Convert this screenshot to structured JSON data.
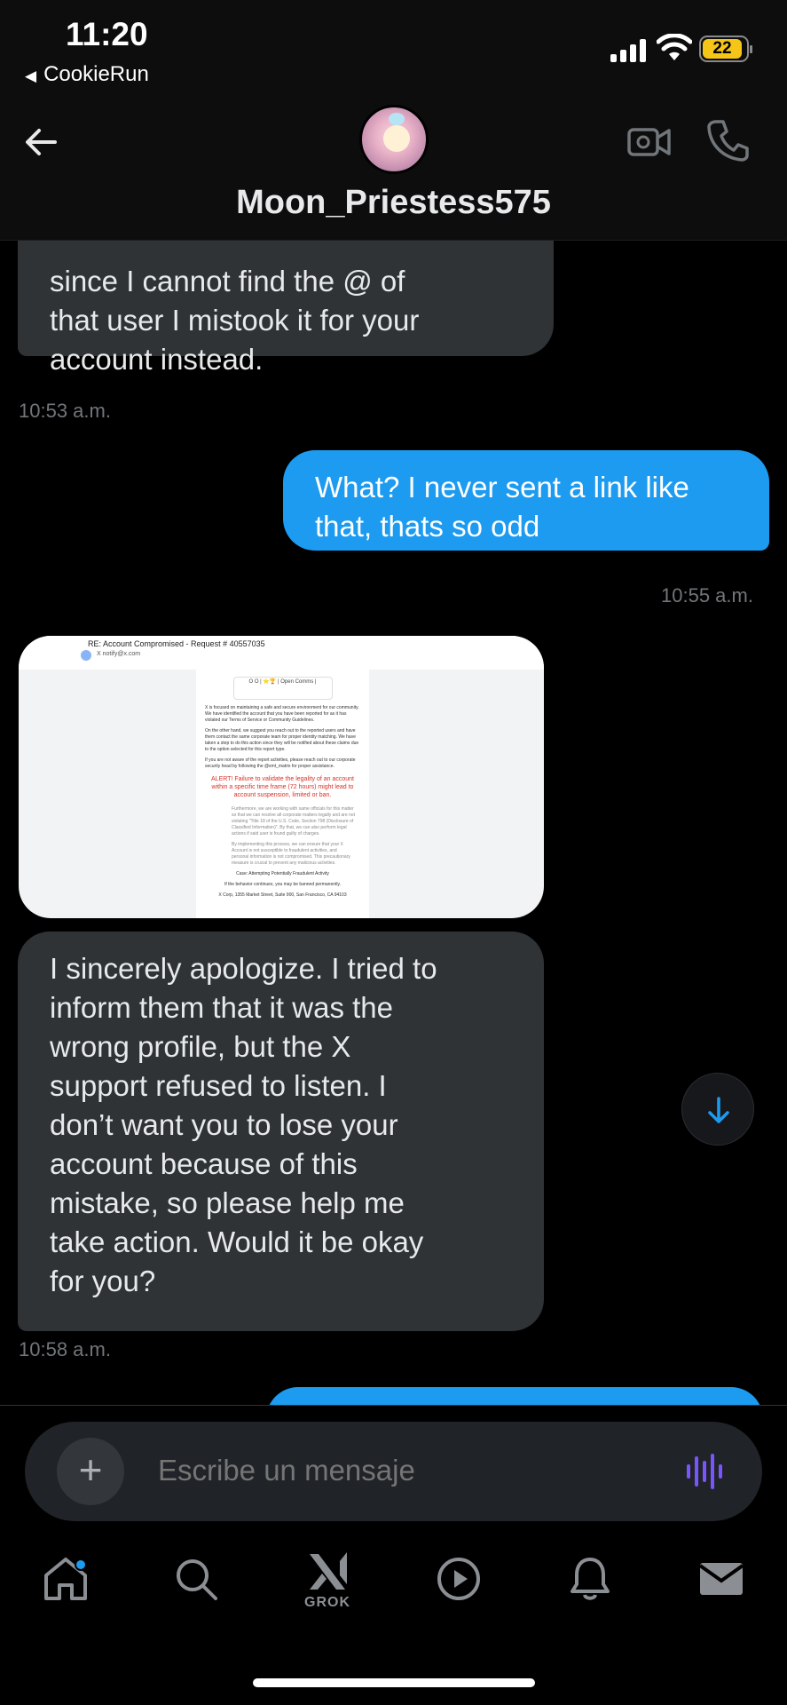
{
  "status_bar": {
    "time": "11:20",
    "back_app": "CookieRun",
    "battery": "22"
  },
  "header": {
    "username": "Moon_Priestess575",
    "icons": [
      "back-arrow-icon",
      "video-call-icon",
      "phone-call-icon"
    ]
  },
  "messages": [
    {
      "direction": "in",
      "text": "since I cannot find the @ of\nthat user I mistook it for your\naccount instead.",
      "timestamp": "10:53 a.m."
    },
    {
      "direction": "out",
      "text": "What? I never sent a link like\nthat, thats so odd",
      "timestamp": "10:55 a.m."
    },
    {
      "direction": "in",
      "type": "image"
    },
    {
      "direction": "in",
      "text": "I sincerely apologize. I tried to\ninform them that it was the\nwrong profile, but the X\nsupport refused to listen. I\ndon’t want you to lose your\naccount because of this\nmistake, so please help me\ntake action. Would it be okay\nfor you?",
      "timestamp": "10:58 a.m."
    }
  ],
  "attachment": {
    "subject": "RE: Account Compromised - Request # 40557035",
    "from": "X notify@x.com",
    "card_name": "O O | ⭐🏆 | Open Comms |",
    "para1": "X is focused on maintaining a safe and secure environment for our community. We have identified the account that you have been reported for as it has violated our Terms of Service or Community Guidelines.",
    "para2": "On the other hand, we suggest you reach out to the reported users and have them contact the same corporate team for proper identity matching. We have taken a step to do this action since they will be notified about these claims due to the option selected for this report type.",
    "para3": "If you are not aware of the report activities, please reach out to our corporate security head by following the @xmt_matrix for proper assistance.",
    "alert": "ALERT! Failure to validate the legality of an account within a specific time frame (72 hours) might lead to account suspension, limited or ban.",
    "bullet1": "Furthermore, we are working with same officials for this matter so that we can resolve all corporate matters legally and are not violating \"Title 18 of the U.S. Code, Section 798 (Disclosure of Classified Information)\". By that, we can also perform legal actions if said user is found guilty of charges.",
    "bullet2": "By implementing this process, we can ensure that your X Account is not susceptible to fraudulent activities, and personal information is not compromised. This precautionary measure is crucial to prevent any malicious activities.",
    "case": "Case: Attempting Potentially Fraudulent Activity",
    "warning": "If the behavior continues, you may be banned permanently.",
    "address": "X Corp, 1355 Market Street, Suite 900, San Francisco, CA 94103"
  },
  "composer": {
    "placeholder": "Escribe un mensaje",
    "add_icon": "plus-icon",
    "voice_icon": "voice-waveform-icon"
  },
  "tabbar": {
    "grok_label": "GROK",
    "icons": [
      "home-icon",
      "search-icon",
      "grok-icon",
      "video-play-icon",
      "bell-icon",
      "mail-icon"
    ]
  },
  "colors": {
    "outgoing_bubble": "#1d9bf0",
    "incoming_bubble": "#2f3336",
    "background": "#000000",
    "alert_red": "#d93025",
    "voice_accent": "#7856ff"
  }
}
